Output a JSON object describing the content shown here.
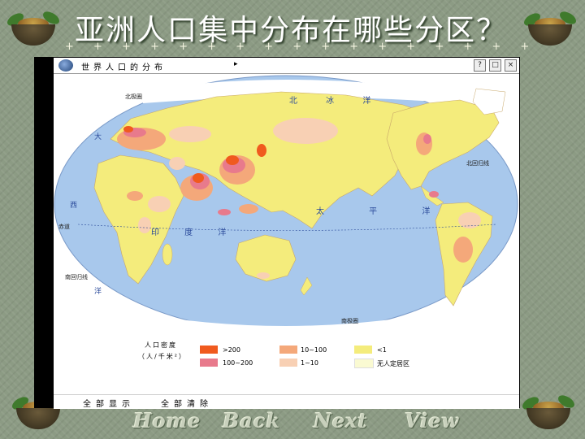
{
  "slide": {
    "title": "亚洲人口集中分布在哪些分区？",
    "stars": "+ + + + + + + + + + + + + + + + + + + + + + + + + + + + + + +"
  },
  "window": {
    "caption": "世界人口的分布",
    "arrow": "▸",
    "buttons": [
      "?",
      "□",
      "×"
    ]
  },
  "map": {
    "labels": {
      "arctic_circle": "北极圈",
      "tropic_cancer": "北回归线",
      "equator": "赤道",
      "tropic_capricorn": "南回归线",
      "antarctic_circle": "南极圈",
      "arctic_ocean": "北 冰 洋",
      "pacific_ocean": "太 平 洋",
      "indian_ocean": "印 度 洋",
      "atlantic_w1": "大",
      "atlantic_w2": "西",
      "atlantic_w3": "洋"
    }
  },
  "legend": {
    "title": "人口密度",
    "unit": "（人/千米²）",
    "items": [
      {
        "label": ">200",
        "color": "#f05a1e"
      },
      {
        "label": "100~200",
        "color": "#e87a8c"
      },
      {
        "label": "10~100",
        "color": "#f4a87a"
      },
      {
        "label": "1~10",
        "color": "#f8d0b4"
      },
      {
        "label": "<1",
        "color": "#f4ec7c"
      },
      {
        "label": "无人定居区",
        "color": "#fafad2"
      }
    ]
  },
  "bottom": {
    "show_all": "全部显示",
    "clear_all": "全部清除"
  },
  "nav": {
    "home": "Home",
    "back": "Back",
    "next": "Next",
    "view": "View"
  },
  "colors": {
    "ocean": "#a8c8ec",
    "land_default": "#f4ec7c",
    "ice": "#ffffff"
  }
}
